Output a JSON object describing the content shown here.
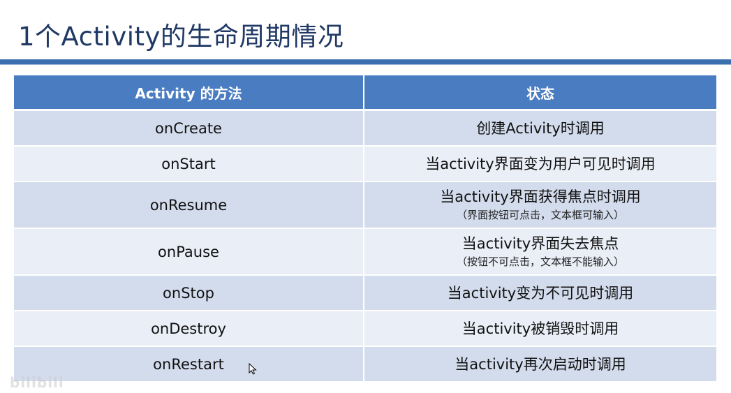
{
  "slide": {
    "title": "1个Activity的生命周期情况"
  },
  "table": {
    "headers": [
      "Activity 的方法",
      "状态"
    ],
    "rows": [
      {
        "method": "onCreate",
        "state": "创建Activity时调用",
        "note": ""
      },
      {
        "method": "onStart",
        "state": "当activity界面变为用户可见时调用",
        "note": ""
      },
      {
        "method": "onResume",
        "state": "当activity界面获得焦点时调用",
        "note": "（界面按钮可点击，文本框可输入）"
      },
      {
        "method": "onPause",
        "state": "当activity界面失去焦点",
        "note": "（按钮不可点击，文本框不能输入）"
      },
      {
        "method": "onStop",
        "state": "当activity变为不可见时调用",
        "note": ""
      },
      {
        "method": "onDestroy",
        "state": "当activity被销毁时调用",
        "note": ""
      },
      {
        "method": "onRestart",
        "state": "当activity再次启动时调用",
        "note": ""
      }
    ]
  },
  "watermark": "bilibili",
  "colors": {
    "title": "#1f3864",
    "rule": "#3b6fb0",
    "header_bg": "#4a7cc2",
    "row_dark": "#d3dcec",
    "row_light": "#eaeef6"
  }
}
